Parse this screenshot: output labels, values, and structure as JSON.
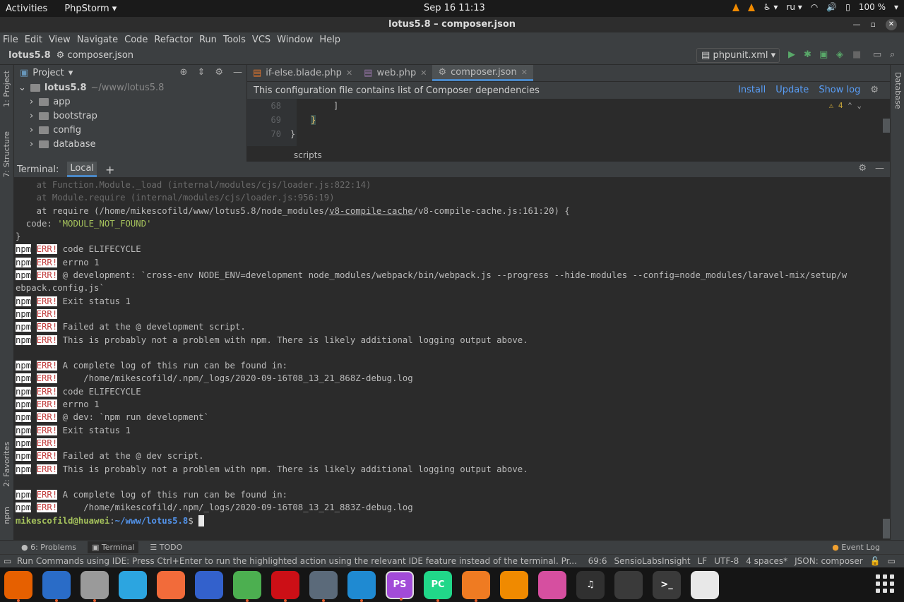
{
  "topbar": {
    "activities": "Activities",
    "app_name": "PhpStorm",
    "clock": "Sep 16  11:13",
    "lang": "ru",
    "battery": "100 %"
  },
  "window": {
    "title": "lotus5.8 – composer.json"
  },
  "menu": [
    "File",
    "Edit",
    "View",
    "Navigate",
    "Code",
    "Refactor",
    "Run",
    "Tools",
    "VCS",
    "Window",
    "Help"
  ],
  "nav": {
    "project": "lotus5.8",
    "file": "composer.json",
    "run_config": "phpunit.xml"
  },
  "left_strip": {
    "project": "1: Project",
    "structure": "7: Structure",
    "favorites": "2: Favorites",
    "npm": "npm"
  },
  "right_strip": {
    "database": "Database"
  },
  "project_panel": {
    "title": "Project",
    "root": "lotus5.8",
    "root_path": "~/www/lotus5.8",
    "items": [
      "app",
      "bootstrap",
      "config",
      "database"
    ]
  },
  "editor": {
    "tabs": [
      "if-else.blade.php",
      "web.php",
      "composer.json"
    ],
    "notice": "This configuration file contains list of Composer dependencies",
    "actions": [
      "Install",
      "Update",
      "Show log"
    ],
    "warnings": "4",
    "lines": [
      {
        "num": "68",
        "text": "]"
      },
      {
        "num": "69",
        "text": "}"
      },
      {
        "num": "70",
        "text": "}"
      }
    ],
    "breadcrumb": "scripts"
  },
  "terminal": {
    "label": "Terminal:",
    "tab": "Local",
    "add": "+",
    "lines": [
      {
        "kind": "dim",
        "text": "    at Function.Module._load (internal/modules/cjs/loader.js:822:14)"
      },
      {
        "kind": "dim",
        "text": "    at Module.require (internal/modules/cjs/loader.js:956:19)"
      },
      {
        "kind": "req",
        "pre": "    at require (/home/mikescofild/www/lotus5.8/node_modules/",
        "link": "v8-compile-cache",
        "post": "/v8-compile-cache.js:161:20) {"
      },
      {
        "kind": "code",
        "pre": "  code: ",
        "str": "'MODULE_NOT_FOUND'"
      },
      {
        "kind": "plain",
        "text": "}"
      },
      {
        "kind": "err",
        "text": "code ELIFECYCLE"
      },
      {
        "kind": "err",
        "text": "errno 1"
      },
      {
        "kind": "err",
        "text": "@ development: `cross-env NODE_ENV=development node_modules/webpack/bin/webpack.js --progress --hide-modules --config=node_modules/laravel-mix/setup/w"
      },
      {
        "kind": "plain",
        "text": "ebpack.config.js`"
      },
      {
        "kind": "err",
        "text": "Exit status 1"
      },
      {
        "kind": "err",
        "text": ""
      },
      {
        "kind": "err",
        "text": "Failed at the @ development script."
      },
      {
        "kind": "err",
        "text": "This is probably not a problem with npm. There is likely additional logging output above."
      },
      {
        "kind": "plain",
        "text": ""
      },
      {
        "kind": "err",
        "text": "A complete log of this run can be found in:"
      },
      {
        "kind": "err",
        "text": "    /home/mikescofild/.npm/_logs/2020-09-16T08_13_21_868Z-debug.log"
      },
      {
        "kind": "err",
        "text": "code ELIFECYCLE"
      },
      {
        "kind": "err",
        "text": "errno 1"
      },
      {
        "kind": "err",
        "text": "@ dev: `npm run development`"
      },
      {
        "kind": "err",
        "text": "Exit status 1"
      },
      {
        "kind": "err",
        "text": ""
      },
      {
        "kind": "err",
        "text": "Failed at the @ dev script."
      },
      {
        "kind": "err",
        "text": "This is probably not a problem with npm. There is likely additional logging output above."
      },
      {
        "kind": "plain",
        "text": ""
      },
      {
        "kind": "err",
        "text": "A complete log of this run can be found in:"
      },
      {
        "kind": "err",
        "text": "    /home/mikescofild/.npm/_logs/2020-09-16T08_13_21_883Z-debug.log"
      },
      {
        "kind": "prompt",
        "user": "mikescofild@huawei",
        "path": "~/www/lotus5.8",
        "sym": "$ "
      }
    ],
    "npm_tag": "npm",
    "err_tag": "ERR!"
  },
  "bottom_tabs": {
    "problems": "6: Problems",
    "terminal": "Terminal",
    "todo": "TODO",
    "event_log": "Event Log"
  },
  "status": {
    "message": "Run Commands using IDE: Press Ctrl+Enter to run the highlighted action using the relevant IDE feature instead of the terminal. Pr...",
    "pos": "69:6",
    "plugin": "SensioLabsInsight",
    "eol": "LF",
    "enc": "UTF-8",
    "indent": "4 spaces*",
    "schema": "JSON: composer"
  },
  "dock": [
    {
      "name": "firefox-icon",
      "label": "",
      "color": "#e66000"
    },
    {
      "name": "thunderbird-icon",
      "label": "",
      "color": "#2a6cc7"
    },
    {
      "name": "files-icon",
      "label": "",
      "color": "#9a9a9a"
    },
    {
      "name": "telegram-icon",
      "label": "",
      "color": "#2ca5e0"
    },
    {
      "name": "postman-icon",
      "label": "",
      "color": "#f26b3a"
    },
    {
      "name": "simplenote-icon",
      "label": "",
      "color": "#3361cc"
    },
    {
      "name": "chrome-icon",
      "label": "",
      "color": "#4caf50"
    },
    {
      "name": "opera-icon",
      "label": "",
      "color": "#cc0f16"
    },
    {
      "name": "settings-icon",
      "label": "",
      "color": "#5b6a7a"
    },
    {
      "name": "vscode-icon",
      "label": "",
      "color": "#1f8ad2"
    },
    {
      "name": "phpstorm-icon",
      "label": "PS",
      "color": "#a24bd8"
    },
    {
      "name": "pycharm-icon",
      "label": "PC",
      "color": "#21d789"
    },
    {
      "name": "gitkraken-icon",
      "label": "",
      "color": "#ef7b22"
    },
    {
      "name": "vlc-icon",
      "label": "",
      "color": "#f08a00"
    },
    {
      "name": "gem-icon",
      "label": "",
      "color": "#d64fa0"
    },
    {
      "name": "music-icon",
      "label": "♫",
      "color": "#303030"
    },
    {
      "name": "system-monitor-icon",
      "label": "",
      "color": "#3a3a3a"
    },
    {
      "name": "terminal-icon",
      "label": ">_",
      "color": "#3a3a3a"
    },
    {
      "name": "document-viewer-icon",
      "label": "",
      "color": "#e8e8e8"
    }
  ]
}
